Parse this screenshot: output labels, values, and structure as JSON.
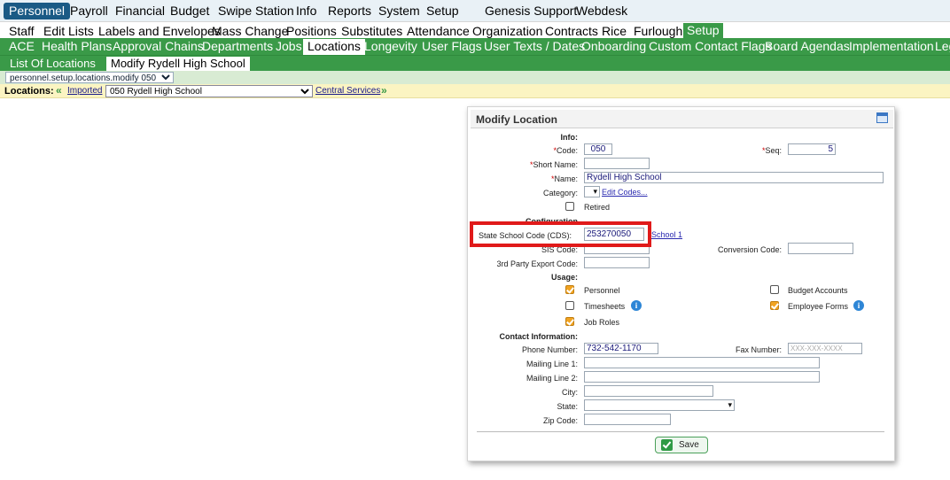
{
  "top_menu": {
    "active": "Personnel",
    "items": [
      "Payroll",
      "Financial",
      "Budget",
      "Swipe Station",
      "Info",
      "Reports",
      "System",
      "Setup",
      "Genesis Support",
      "Webdesk"
    ]
  },
  "sub_menu": {
    "items": [
      "Staff",
      "Edit Lists",
      "Labels and Envelopes",
      "Mass Change",
      "Positions",
      "Substitutes",
      "Attendance",
      "Organization",
      "Contracts",
      "Rice",
      "Furlough"
    ],
    "selected": "Setup"
  },
  "setup_tabs": {
    "items": [
      "ACE",
      "Health Plans",
      "Approval Chains",
      "Departments",
      "Jobs"
    ],
    "selected": "Locations",
    "items_after": [
      "Longevity",
      "User Flags",
      "User Texts / Dates",
      "Onboarding",
      "Custom Contact Flags",
      "Board Agendas",
      "Implementation",
      "Leg"
    ]
  },
  "page_tabs": {
    "list": "List Of Locations",
    "selected": "Modify Rydell High School"
  },
  "screen_select": {
    "value": "personnel.setup.locations.modify 050"
  },
  "locations_bar": {
    "label": "Locations:",
    "prev_link": "Imported",
    "current": "050 Rydell High School",
    "next_link": "Central Services"
  },
  "form": {
    "title": "Modify Location",
    "sections": {
      "info": "Info:",
      "configuration": "Configuration",
      "usage": "Usage:",
      "contact": "Contact Information:"
    },
    "labels": {
      "code": "Code:",
      "seq": "Seq:",
      "short_name": "Short Name:",
      "name": "Name:",
      "category": "Category:",
      "retired": "Retired",
      "state_school_code": "State School Code (CDS):",
      "sis_code": "SIS Code:",
      "conversion_code": "Conversion Code:",
      "export_code": "3rd Party Export Code:",
      "phone": "Phone Number:",
      "fax": "Fax Number:",
      "mail1": "Mailing Line 1:",
      "mail2": "Mailing Line 2:",
      "city": "City:",
      "state": "State:",
      "zip": "Zip Code:"
    },
    "required_mark": "*",
    "values": {
      "code": "050",
      "seq": "5",
      "short_name": "",
      "name": "Rydell High School",
      "state_school_code": "253270050",
      "sis_code": "",
      "conversion_code": "",
      "export_code": "",
      "phone": "732-542-1170",
      "mail1": "",
      "mail2": "",
      "city": "",
      "zip": ""
    },
    "placeholders": {
      "fax": "XXX-XXX-XXXX"
    },
    "edit_codes_link": "Edit Codes...",
    "school_link": "School 1",
    "usage": [
      {
        "label": "Personnel",
        "checked": true
      },
      {
        "label": "Timesheets",
        "checked": false
      },
      {
        "label": "Job Roles",
        "checked": true
      },
      {
        "label": "Budget Accounts",
        "checked": false
      },
      {
        "label": "Employee Forms",
        "checked": true
      }
    ],
    "retired_checked": false,
    "save_label": "Save",
    "info_icon": "i"
  },
  "colors": {
    "nav_green": "#3a9a48",
    "active_blue": "#1a5a85",
    "highlight_red": "#e01a1a",
    "check_orange": "#f1a321"
  }
}
